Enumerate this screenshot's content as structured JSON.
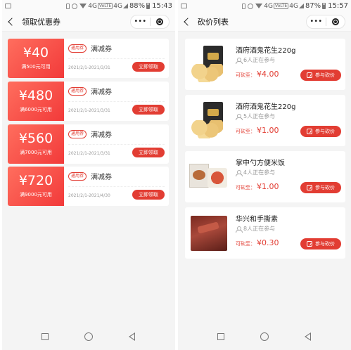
{
  "left": {
    "status": {
      "network": "4G",
      "volte": "VoLTE",
      "network2": "4G",
      "battery": "88%",
      "time": "15:43"
    },
    "title": "领取优惠券",
    "capsule_more": "•••",
    "coupons": [
      {
        "amount": "¥40",
        "condition": "满500元可用",
        "tag": "通用券",
        "name": "满减券",
        "date": "2021/2/1-2021/3/31",
        "button": "立即领取"
      },
      {
        "amount": "¥480",
        "condition": "满6000元可用",
        "tag": "通用券",
        "name": "满减券",
        "date": "2021/2/1-2021/3/31",
        "button": "立即领取"
      },
      {
        "amount": "¥560",
        "condition": "满7000元可用",
        "tag": "通用券",
        "name": "满减券",
        "date": "2021/2/1-2021/3/31",
        "button": "立即领取"
      },
      {
        "amount": "¥720",
        "condition": "满9000元可用",
        "tag": "通用券",
        "name": "满减券",
        "date": "2021/2/1-2021/4/30",
        "button": "立即领取"
      }
    ]
  },
  "right": {
    "status": {
      "network": "4G",
      "volte": "VoLTE",
      "network2": "4G",
      "battery": "87%",
      "time": "15:57"
    },
    "title": "砍价列表",
    "capsule_more": "•••",
    "items": [
      {
        "name": "酒府酒鬼花生220g",
        "joined": "6人正在参与",
        "price_label": "可砍至：",
        "price": "¥4.00",
        "button": "参与砍价"
      },
      {
        "name": "酒府酒鬼花生220g",
        "joined": "5人正在参与",
        "price_label": "可砍至：",
        "price": "¥1.00",
        "button": "参与砍价"
      },
      {
        "name": "掌中勺方便米饭",
        "joined": "4人正在参与",
        "price_label": "可砍至：",
        "price": "¥1.00",
        "button": "参与砍价"
      },
      {
        "name": "华兴和手撕素",
        "joined": "8人正在参与",
        "price_label": "可砍至：",
        "price": "¥0.30",
        "button": "参与砍价"
      }
    ]
  }
}
